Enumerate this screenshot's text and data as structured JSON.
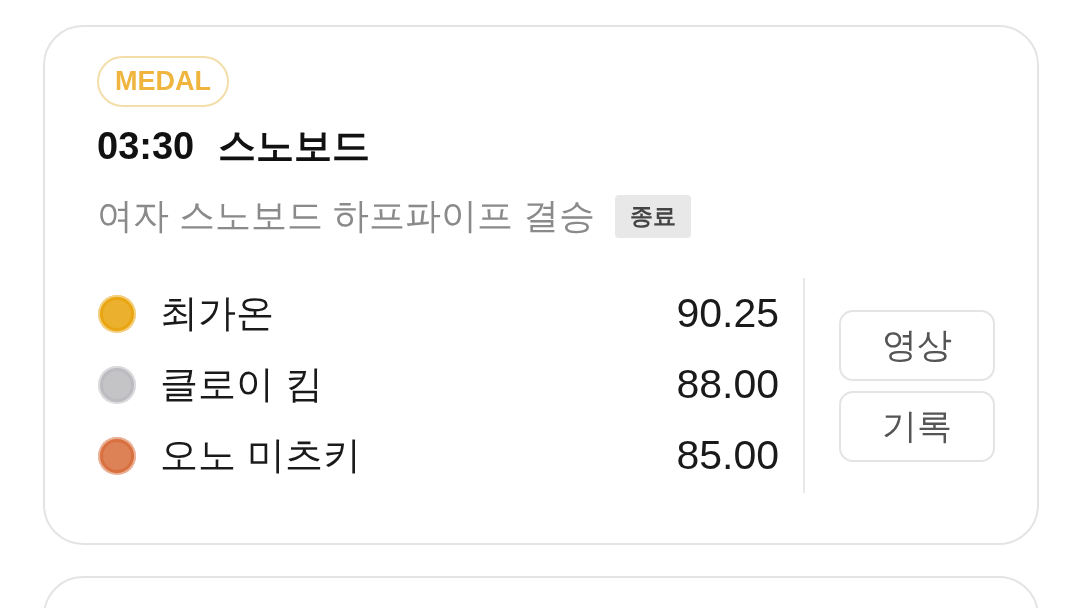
{
  "card": {
    "badge": "MEDAL",
    "time": "03:30",
    "sport": "스노보드",
    "event": "여자 스노보드 하프파이프 결승",
    "status": "종료",
    "results": [
      {
        "name": "최가온",
        "score": "90.25",
        "color": "#e9a612"
      },
      {
        "name": "클로이 킴",
        "score": "88.00",
        "color": "#bcbcc0"
      },
      {
        "name": "오노 미츠키",
        "score": "85.00",
        "color": "#d9703f"
      }
    ],
    "buttons": [
      "영상",
      "기록"
    ]
  }
}
